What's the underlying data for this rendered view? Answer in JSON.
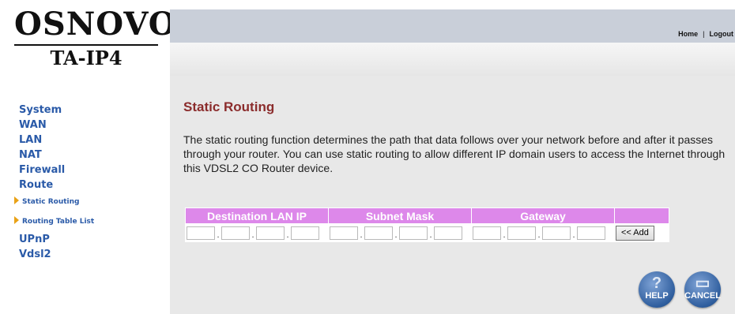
{
  "logo": {
    "brand": "OSNOVO",
    "model": "TA-IP4"
  },
  "nav": {
    "items": [
      "System",
      "WAN",
      "LAN",
      "NAT",
      "Firewall",
      "Route"
    ],
    "sub": [
      "Static Routing",
      "Routing Table List"
    ],
    "after": [
      "UPnP",
      "Vdsl2"
    ]
  },
  "header": {
    "home": "Home",
    "separator": "|",
    "logout": "Logout"
  },
  "page": {
    "title": "Static Routing",
    "description": "The static routing function determines the path that data follows over your network before and after it passes through your router. You can use static routing to allow different IP domain users to access the Internet through this VDSL2 CO Router device."
  },
  "table": {
    "headers": [
      "Destination LAN IP",
      "Subnet Mask",
      "Gateway",
      ""
    ],
    "add_label": "<< Add"
  },
  "buttons": {
    "help": "HELP",
    "cancel": "CANCEL"
  },
  "colors": {
    "nav": "#2a5aa8",
    "title": "#8b2c2c",
    "table_header": "#dd88ea",
    "content_bg": "#e8e8e8",
    "topbar": "#c9cfd9",
    "arrow": "#e9a217"
  }
}
